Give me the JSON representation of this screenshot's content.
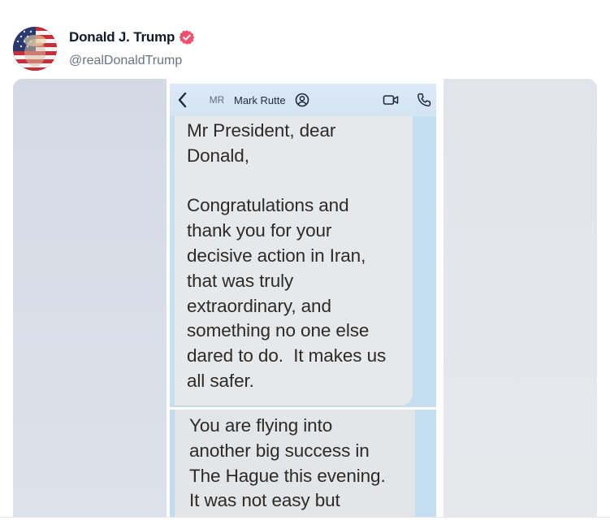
{
  "post": {
    "author_name": "Donald J. Trump",
    "author_handle": "@realDonaldTrump",
    "verified_badge_icon": "verified-check-icon",
    "verified_color": "#f0506e",
    "avatar_icon": "profile-avatar-flag"
  },
  "screenshot": {
    "header": {
      "back_icon": "chevron-left-icon",
      "contact_initials": "MR",
      "contact_name": "Mark Rutte",
      "contact_icon": "contact-card-icon",
      "video_icon": "video-call-icon",
      "phone_icon": "phone-call-icon"
    },
    "messages": [
      {
        "text": "Mr President, dear\nDonald,\n\nCongratulations and\nthank you for your\ndecisive action in Iran,\nthat was truly\nextraordinary, and\nsomething no one else\ndared to do.  It makes us\nall safer."
      },
      {
        "text": "You are flying into\nanother big success in\nThe Hague this evening.\nIt was not easy but"
      }
    ],
    "colors": {
      "chat_background": "#c6dff0",
      "bubble": "#e7e8ea",
      "header_bar": "#d8e6f4"
    }
  }
}
